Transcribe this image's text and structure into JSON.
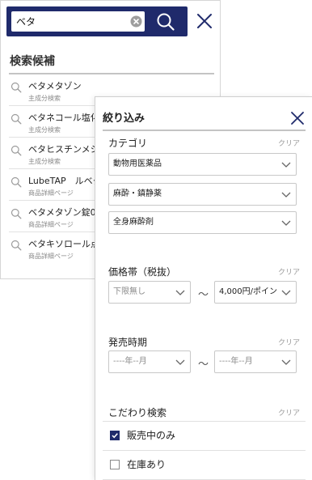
{
  "search": {
    "query": "ベタ",
    "icons": {
      "clear": "clear-circle-icon",
      "search": "search-icon",
      "close": "close-icon"
    },
    "colors": {
      "accent": "#1f2a6b"
    }
  },
  "candidates": {
    "heading": "検索候補",
    "items": [
      {
        "title": "ベタメタゾン",
        "sub": "主成分検索"
      },
      {
        "title": "ベタネコール塩化",
        "sub": "主成分検索"
      },
      {
        "title": "ベタヒスチンメシ",
        "sub": "主成分検索"
      },
      {
        "title": "LubeTAP　ルベタ",
        "sub": "商品詳細ページ"
      },
      {
        "title": "ベタメタゾン錠0.",
        "sub": "商品詳細ページ"
      },
      {
        "title": "ベタキソロール点",
        "sub": "商品詳細ページ"
      }
    ]
  },
  "filter": {
    "title": "絞り込み",
    "clear_label": "クリア",
    "category": {
      "label": "カテゴリ",
      "selects": [
        "動物用医薬品",
        "麻酔・鎮静薬",
        "全身麻酔剤"
      ]
    },
    "price": {
      "label": "価格帯（税抜）",
      "min": "下限無し",
      "max": "4,000円/ポイン",
      "separator": "〜"
    },
    "release": {
      "label": "発売時期",
      "from": "----年--月",
      "to": "----年--月",
      "separator": "〜"
    },
    "preferences": {
      "label": "こだわり検索",
      "options": [
        {
          "label": "販売中のみ",
          "checked": true
        },
        {
          "label": "在庫あり",
          "checked": false
        }
      ]
    }
  }
}
